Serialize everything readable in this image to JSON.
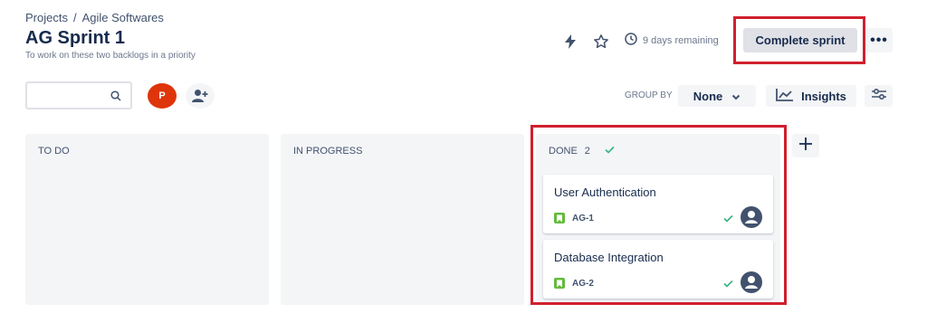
{
  "breadcrumb": {
    "items": [
      "Projects",
      "Agile Softwares"
    ],
    "separator": "/"
  },
  "sprint": {
    "title": "AG Sprint 1",
    "goal": "To work on these two backlogs in a priority"
  },
  "header": {
    "remaining": "9 days remaining",
    "complete_label": "Complete sprint",
    "more_label": "•••",
    "icons": [
      "lightning-icon",
      "star-icon",
      "clock-icon"
    ]
  },
  "toolbar": {
    "search_value": "",
    "search_placeholder": "",
    "avatar_initial": "P",
    "group_by_label": "GROUP BY",
    "group_by_value": "None",
    "insights_label": "Insights"
  },
  "colors": {
    "accent_red": "#d0202e",
    "avatar": "#de350b",
    "story": "#63ba3c",
    "done_check": "#36b37e"
  },
  "board": {
    "columns": [
      {
        "title": "TO DO",
        "count": ""
      },
      {
        "title": "IN PROGRESS",
        "count": ""
      },
      {
        "title": "DONE",
        "count": "2"
      }
    ],
    "cards": [
      {
        "title": "User Authentication",
        "key": "AG-1"
      },
      {
        "title": "Database Integration",
        "key": "AG-2"
      }
    ]
  }
}
